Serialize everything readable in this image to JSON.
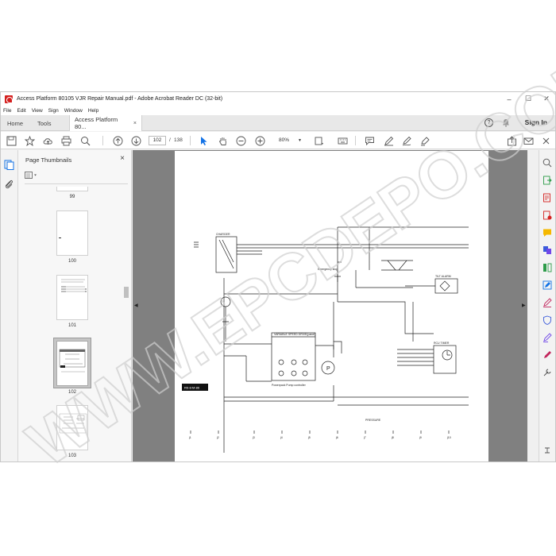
{
  "window": {
    "title": "Access Platform 80105 VJR Repair Manual.pdf - Adobe Acrobat Reader DC (32-bit)",
    "controls": [
      "–",
      "☐",
      "✕"
    ]
  },
  "menu": [
    "File",
    "Edit",
    "View",
    "Sign",
    "Window",
    "Help"
  ],
  "tabs": {
    "home": "Home",
    "tools": "Tools",
    "document": "Access Platform 80...",
    "close": "×",
    "sign_in": "Sign In"
  },
  "toolbar": {
    "current_page": "102",
    "page_separator": "/",
    "total_pages": "138",
    "zoom": "80%"
  },
  "thumbnails_panel": {
    "title": "Page Thumbnails",
    "close": "×",
    "pages": [
      {
        "label": "99"
      },
      {
        "label": "100"
      },
      {
        "label": "101"
      },
      {
        "label": "102",
        "selected": true
      },
      {
        "label": "103"
      }
    ]
  },
  "document": {
    "page_number": 102,
    "watermark": "WWW.EPCDEPO.COM",
    "labels": {
      "charger": "CHARGER",
      "variable_speed": "VARIABLE SPEED DRIVE(panel)",
      "tilt_alarm": "TILT ALARM",
      "rcu_timer": "RCU TIMER",
      "powerpack": "Powerpack Pump controller",
      "emergency": "Emergency stop",
      "pressure": "PRESSURE",
      "note_box": "R6-8-M-86"
    },
    "columns": [
      "j1",
      "j2",
      "j3",
      "j4",
      "j5",
      "j6",
      "j7",
      "j8",
      "j9",
      "j10"
    ]
  },
  "colors": {
    "accent": "#1473e6",
    "doc_background": "#808080",
    "app_icon": "#d4201f"
  }
}
